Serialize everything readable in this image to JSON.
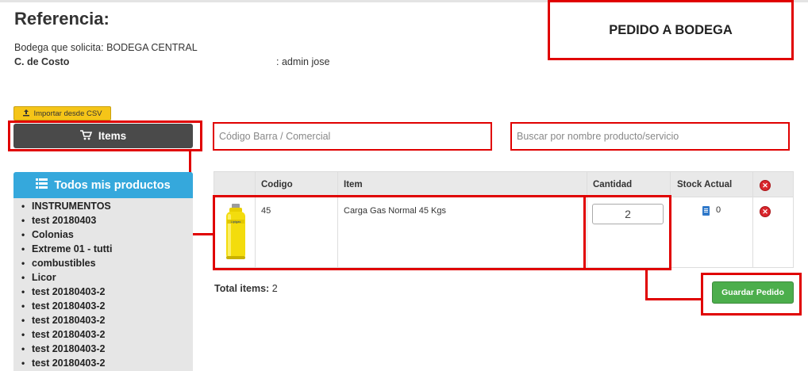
{
  "header": {
    "title": "Referencia:",
    "bodega_label": "Bodega que solicita:",
    "bodega_value": "BODEGA CENTRAL",
    "costo_label": "C. de Costo",
    "user_text": ": admin jose",
    "pedido_label": "PEDIDO A BODEGA"
  },
  "toolbar": {
    "import_csv_label": "Importar desde CSV",
    "items_label": "Items",
    "todos_label": "Todos mis productos"
  },
  "categories": [
    "INSTRUMENTOS",
    "test 20180403",
    "Colonias",
    "Extreme 01 - tutti",
    "combustibles",
    "Licor",
    "test 20180403-2",
    "test 20180403-2",
    "test 20180403-2",
    "test 20180403-2",
    "test 20180403-2",
    "test 20180403-2"
  ],
  "search": {
    "codigo_placeholder": "Código Barra / Comercial",
    "nombre_placeholder": "Buscar por nombre producto/servicio"
  },
  "table": {
    "headers": {
      "codigo": "Codigo",
      "item": "Item",
      "cantidad": "Cantidad",
      "stock": "Stock Actual"
    },
    "rows": [
      {
        "codigo": "45",
        "item": "Carga Gas Normal 45 Kgs",
        "cantidad": "2",
        "stock": "0",
        "image_label": "Lipigas"
      }
    ]
  },
  "footer": {
    "total_label": "Total items:",
    "total_value": "2",
    "save_label": "Guardar Pedido"
  },
  "colors": {
    "annotation_red": "#e00000",
    "items_button": "#4a4a4a",
    "todos_button": "#35a8dc",
    "save_button": "#4cae4c",
    "csv_button": "#f5c518"
  },
  "icons": {
    "csv": "upload-icon",
    "items": "cart-icon",
    "todos": "list-icon",
    "remove": "remove-circle-icon",
    "stock": "document-icon"
  }
}
